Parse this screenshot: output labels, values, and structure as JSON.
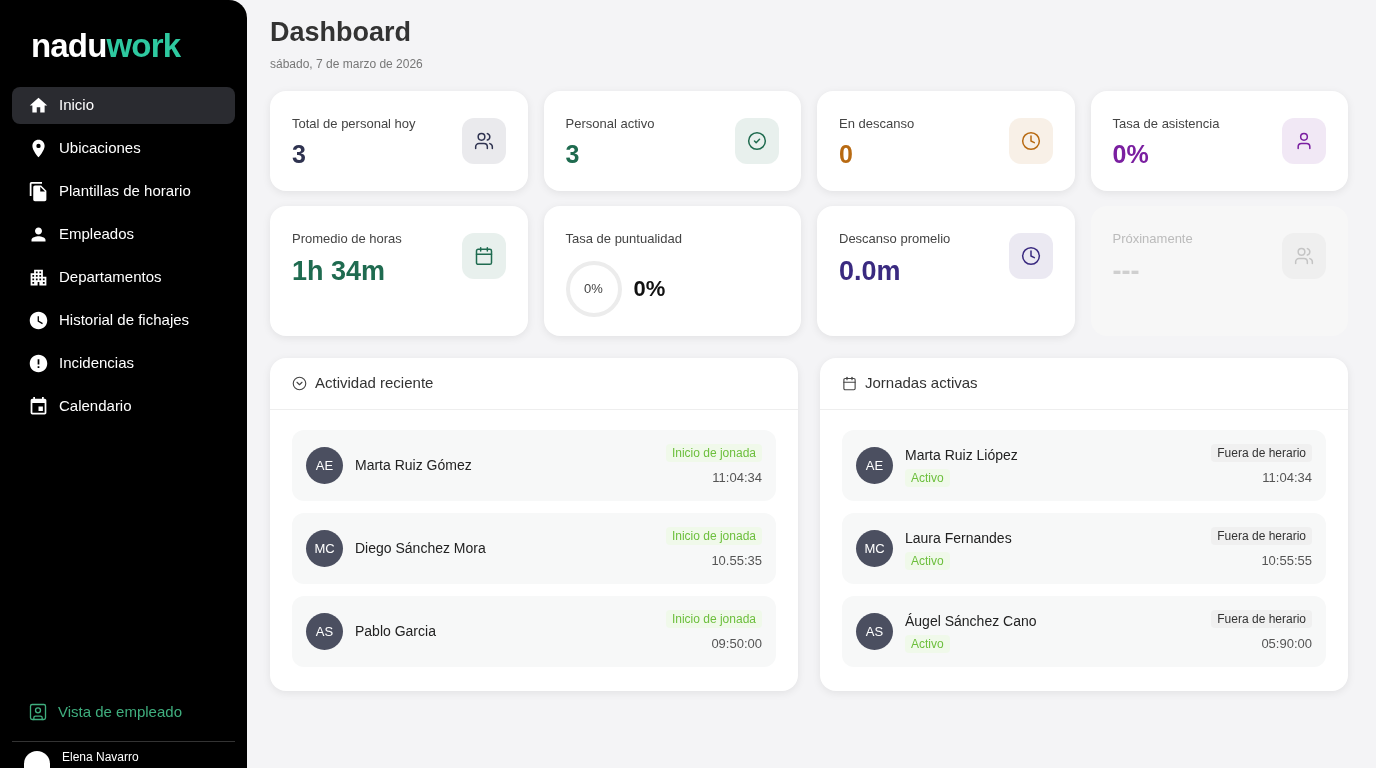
{
  "brand": {
    "part_1": "nadu",
    "part_2": "work"
  },
  "sidebar": {
    "items": [
      {
        "label": "Inicio",
        "selected": true
      },
      {
        "label": "Ubicaciones",
        "selected": false
      },
      {
        "label": "Plantillas de horario",
        "selected": false
      },
      {
        "label": "Empleados",
        "selected": false
      },
      {
        "label": "Departamentos",
        "selected": false
      },
      {
        "label": "Historial de fichajes",
        "selected": false
      },
      {
        "label": "Incidencias",
        "selected": false
      },
      {
        "label": "Calendario",
        "selected": false
      }
    ],
    "employee_view": "Vista de empleado",
    "user": "Elena Navarro"
  },
  "header": {
    "title": "Dashboard",
    "date": "sábado, 7 de marzo de 2026"
  },
  "stats": [
    {
      "kind": "value",
      "color": "#2f3350",
      "label": "Total de personal hoy",
      "value": "3"
    },
    {
      "kind": "value",
      "color": "#1f6b4f",
      "label": "Personal activo",
      "value": "3"
    },
    {
      "kind": "value",
      "color": "#b86a12",
      "label": "En descanso",
      "value": "0"
    },
    {
      "kind": "value",
      "color": "#7a1fa0",
      "label": "Tasa de asistencia",
      "value": "0%"
    },
    {
      "kind": "value",
      "color": "#1f6b50",
      "label": "Promedio de horas",
      "value": "1h 34m"
    },
    {
      "kind": "ring",
      "color": "#111111",
      "label": "Tasa de puntualidad",
      "ring_text": "0%",
      "value": "0%"
    },
    {
      "kind": "value",
      "color": "#3a2a80",
      "label": "Descanso promelio",
      "value": "0.0m"
    },
    {
      "kind": "placeholder",
      "color": "#cfcfcf",
      "label": "Próxinamente",
      "value": "---"
    }
  ],
  "recent_activity": {
    "title": "Actividad reciente",
    "rows": [
      {
        "initials": "AE",
        "name": "Marta Ruiz Gómez",
        "event": "Inicio de jonada",
        "time": "11:04:34"
      },
      {
        "initials": "MC",
        "name": "Diego Sánchez Mora",
        "event": "Inicio de jonada",
        "time": "10.55:35"
      },
      {
        "initials": "AS",
        "name": "Pablo Garcia",
        "event": "Inicio de jonada",
        "time": "09:50:00"
      }
    ]
  },
  "active_shifts": {
    "title": "Jornadas activas",
    "rows": [
      {
        "initials": "AE",
        "name": "Marta Ruiz Liópez",
        "status": "Activo",
        "schedule": "Fuera de herario",
        "time": "11:04:34"
      },
      {
        "initials": "MC",
        "name": "Laura Fernandes",
        "status": "Activo",
        "schedule": "Fuera de herario",
        "time": "10:55:55"
      },
      {
        "initials": "AS",
        "name": "Áugel Sánchez Cano",
        "status": "Activo",
        "schedule": "Fuera de herario",
        "time": "05:90:00"
      }
    ]
  }
}
